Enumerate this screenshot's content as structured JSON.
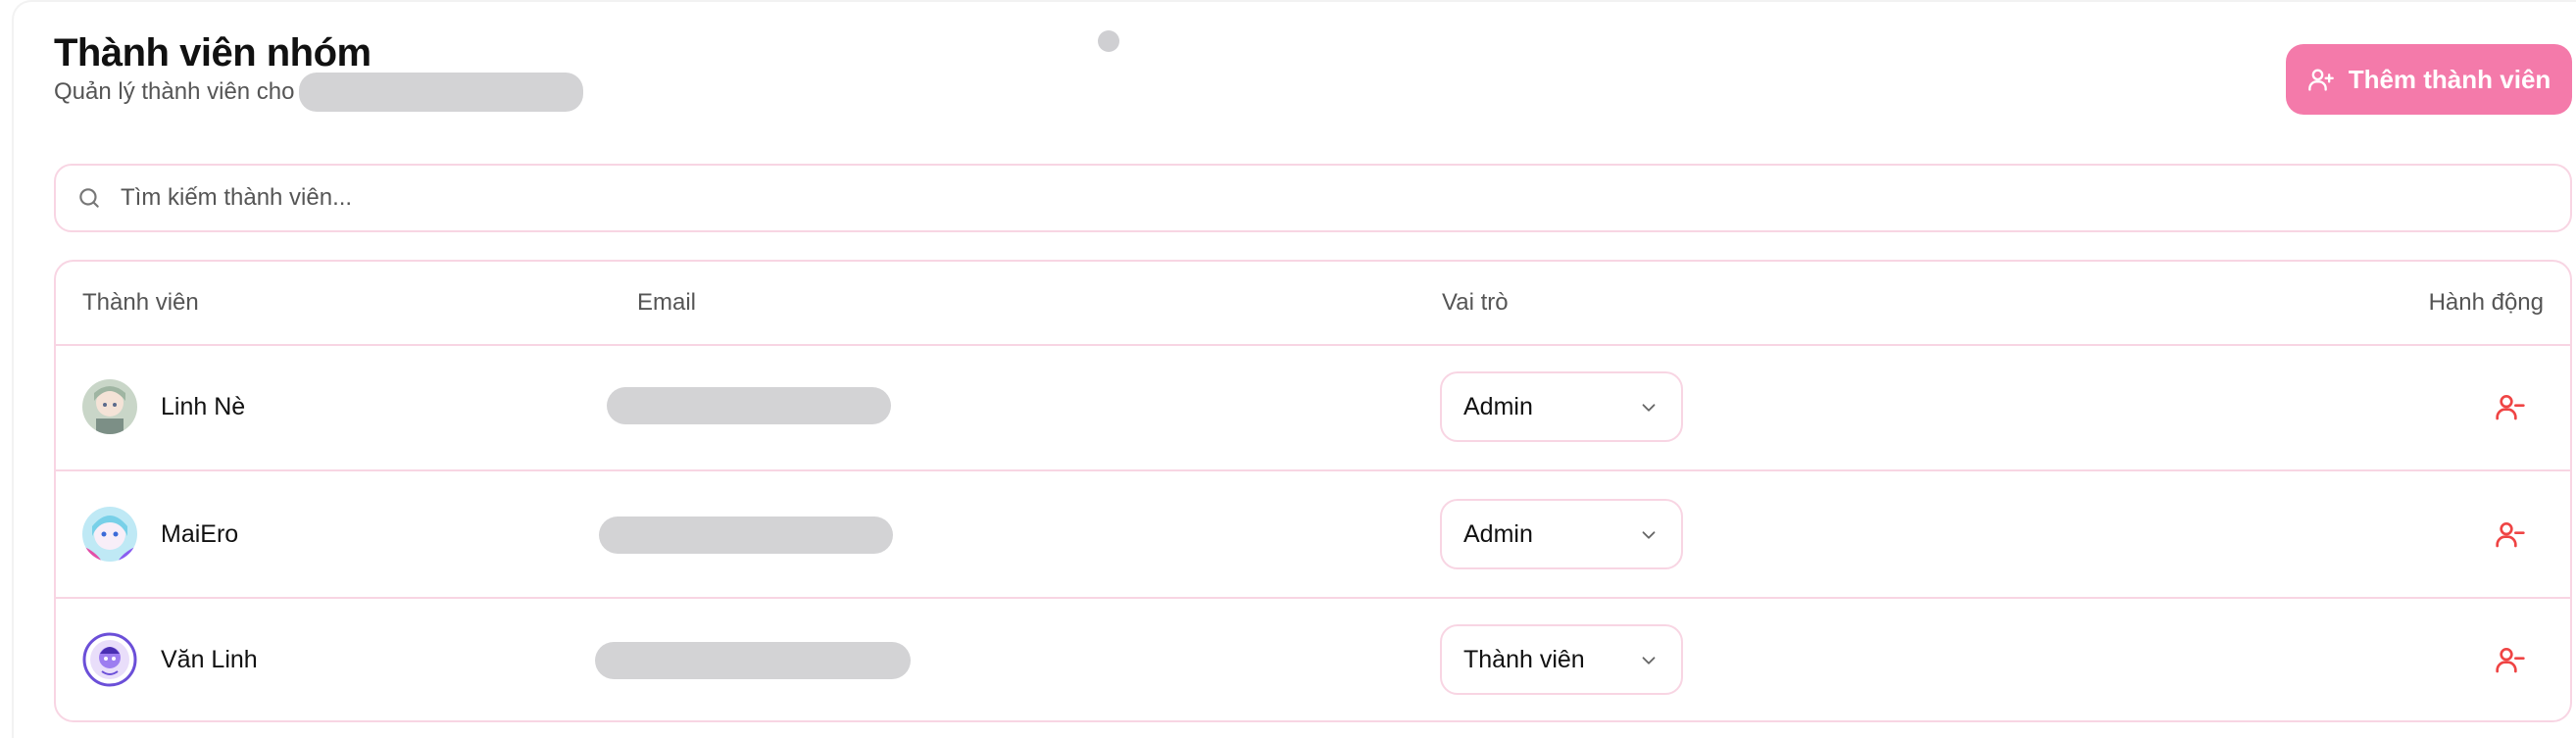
{
  "header": {
    "title": "Thành viên nhóm",
    "subtitle": "Quản lý thành viên cho"
  },
  "actions": {
    "add_member_label": "Thêm thành viên",
    "add_member_icon": "user-plus-icon"
  },
  "search": {
    "placeholder": "Tìm kiếm thành viên...",
    "value": ""
  },
  "table": {
    "columns": [
      "Thành viên",
      "Email",
      "Vai trò",
      "Hành động"
    ],
    "rows": [
      {
        "name": "Linh Nè",
        "role": "Admin"
      },
      {
        "name": "MaiEro",
        "role": "Admin"
      },
      {
        "name": "Văn Linh",
        "role": "Thành viên"
      }
    ],
    "remove_icon": "user-minus-icon"
  },
  "colors": {
    "accent": "#f47aaa",
    "border": "#f8d5e3",
    "danger": "#ef4444",
    "redaction": "#d3d3d5"
  }
}
